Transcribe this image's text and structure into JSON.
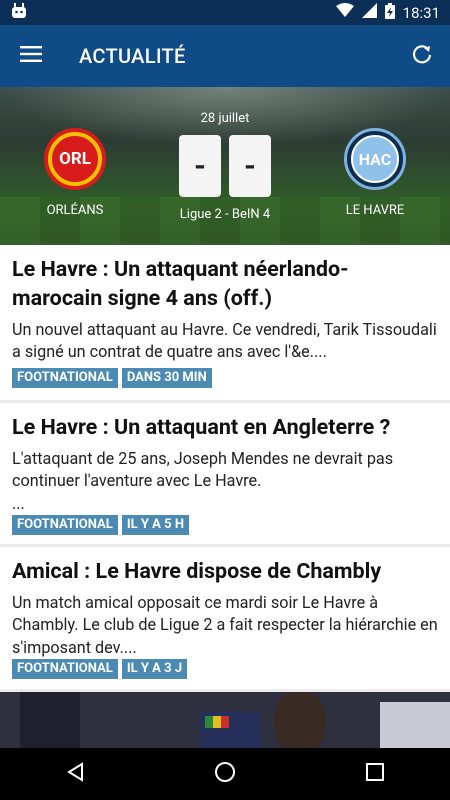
{
  "status": {
    "time": "18:31"
  },
  "appbar": {
    "title": "ACTUALITÉ"
  },
  "match": {
    "date": "28 juillet",
    "home_team": "ORLÉANS",
    "away_team": "LE HAVRE",
    "home_crest": "ORL",
    "away_crest": "HAC",
    "home_score": "-",
    "away_score": "-",
    "competition": "Ligue 2 - BeIN 4"
  },
  "articles": [
    {
      "title": "Le Havre : Un attaquant néerlando-marocain signe 4 ans (off.)",
      "summary": "Un nouvel attaquant au Havre. Ce vendredi, Tarik Tissoudali a signé un contrat de quatre ans avec l'&e....",
      "source": "FOOTNATIONAL",
      "time": "DANS 30 MIN"
    },
    {
      "title": "Le Havre : Un attaquant en Angleterre ?",
      "summary": "L'attaquant de 25 ans, Joseph Mendes ne devrait pas continuer l'aventure avec Le Havre.\n...",
      "source": "FOOTNATIONAL",
      "time": "IL Y A 5 H"
    },
    {
      "title": "Amical : Le Havre dispose de Chambly",
      "summary": "Un match amical opposait ce mardi soir Le Havre à Chambly. Le club de Ligue 2 a fait respecter la hiérarchie en s'imposant dev....",
      "source": "FOOTNATIONAL",
      "time": "IL Y A 3 J"
    }
  ],
  "colors": {
    "appbar": "#0f4b86",
    "statusbar": "#0b2f57",
    "tag": "#4a8ab3"
  }
}
